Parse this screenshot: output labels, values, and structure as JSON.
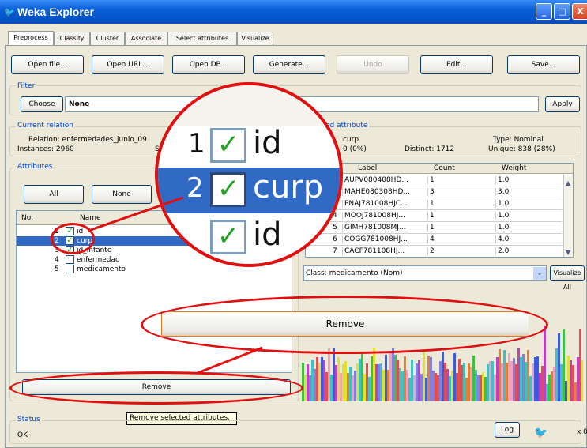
{
  "window": {
    "title": "Weka Explorer",
    "controls": [
      "_",
      "□",
      "X"
    ]
  },
  "tabs": [
    "Preprocess",
    "Classify",
    "Cluster",
    "Associate",
    "Select attributes",
    "Visualize"
  ],
  "toolbar": {
    "open_file": "Open file...",
    "open_url": "Open URL...",
    "open_db": "Open DB...",
    "generate": "Generate...",
    "undo": "Undo",
    "edit": "Edit...",
    "save": "Save..."
  },
  "filter": {
    "label": "Filter",
    "choose": "Choose",
    "value": "None",
    "apply": "Apply"
  },
  "relation": {
    "label": "Current relation",
    "relation_text": "Relation: enfermedades_junio_09",
    "instances_text": "Instances: 2960",
    "sum_letter": "S"
  },
  "selected": {
    "label": "ed attribute",
    "name": "curp",
    "missing": "0 (0%)",
    "distinct": "Distinct: 1712",
    "type": "Type: Nominal",
    "unique": "Unique: 838 (28%)"
  },
  "attributes": {
    "label": "Attributes",
    "all": "All",
    "none": "None",
    "col_no": "No.",
    "col_name": "Name",
    "rows": [
      {
        "no": "1",
        "name": "id",
        "checked": true
      },
      {
        "no": "2",
        "name": "curp",
        "checked": true
      },
      {
        "no": "3",
        "name": "id_infante",
        "checked": true
      },
      {
        "no": "4",
        "name": "enfermedad",
        "checked": false
      },
      {
        "no": "5",
        "name": "medicamento",
        "checked": false
      }
    ],
    "remove": "Remove",
    "tooltip": "Remove selected attributes."
  },
  "lens": {
    "rows": [
      {
        "no": "1",
        "name": "id"
      },
      {
        "no": "2",
        "name": "curp"
      },
      {
        "no": "",
        "name": "id"
      }
    ]
  },
  "labels_table": {
    "headers": [
      "Label",
      "Count",
      "Weight"
    ],
    "rows": [
      {
        "no": "1",
        "label": "AUPV080408HD...",
        "count": "1",
        "weight": "1.0"
      },
      {
        "no": "2",
        "label": "MAHE080308HD...",
        "count": "3",
        "weight": "3.0"
      },
      {
        "no": "3",
        "label": "PNAJ781008HJC...",
        "count": "1",
        "weight": "1.0"
      },
      {
        "no": "4",
        "label": "MOOJ781008HJ...",
        "count": "1",
        "weight": "1.0"
      },
      {
        "no": "5",
        "label": "GIMH781008MJ...",
        "count": "1",
        "weight": "1.0"
      },
      {
        "no": "6",
        "label": "COGG781008HJ...",
        "count": "4",
        "weight": "4.0"
      },
      {
        "no": "7",
        "label": "CACF781108HJ...",
        "count": "2",
        "weight": "2.0"
      }
    ]
  },
  "class_select": {
    "value": "Class: medicamento (Nom)",
    "visualize_all": "Visualize All"
  },
  "zoom_remove": "Remove",
  "status": {
    "label": "Status",
    "text": "OK",
    "log": "Log",
    "xcount": "x 0"
  },
  "colors": {
    "selection": "#316ac5",
    "annotation": "#e01010",
    "title_blue": "#0a5fd8"
  }
}
